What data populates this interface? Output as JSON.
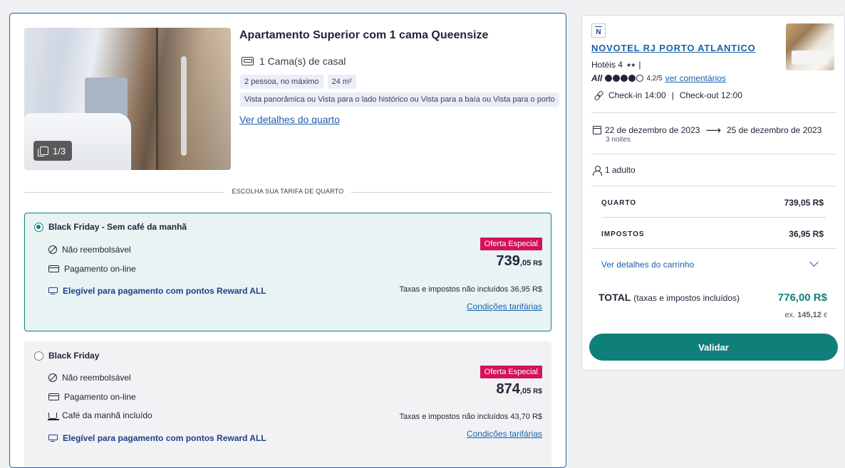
{
  "room": {
    "title": "Apartamento Superior com 1 cama Queensize",
    "beds": "1 Cama(s) de casal",
    "chips_row1": [
      "2 pessoa, no máximo",
      "24 m²"
    ],
    "views": "Vista panorâmica ou Vista para o lado histórico ou Vista para a baía ou Vista para o porto",
    "details_link": "Ver detalhes do quarto",
    "photo_counter": "1/3"
  },
  "rate_section_label": "ESCOLHA SUA TARIFA DE QUARTO",
  "rates": [
    {
      "name": "Black Friday - Sem café da manhã",
      "selected": true,
      "features": [
        "Não reembolsável",
        "Pagamento on-line"
      ],
      "reward": "Elegível para pagamento com pontos Reward ALL",
      "badge": "Oferta Especial",
      "price_int": "739",
      "price_dec": ",05",
      "currency": "R$",
      "taxes": "Taxas e impostos não incluídos 36,95 R$",
      "conditions": "Condições tarifárias"
    },
    {
      "name": "Black Friday",
      "selected": false,
      "features": [
        "Não reembolsável",
        "Pagamento on-line",
        "Café da manhã incluído"
      ],
      "reward": "Elegível para pagamento com pontos Reward ALL",
      "badge": "Oferta Especial",
      "price_int": "874",
      "price_dec": ",05",
      "currency": "R$",
      "taxes": "Taxas e impostos não incluídos 43,70 R$",
      "conditions": "Condições tarifárias"
    }
  ],
  "summary": {
    "brand_letter": "N",
    "hotel_name": "NOVOTEL RJ PORTO ATLANTICO",
    "category": "Hotéis 4",
    "stars_glyph": "★★",
    "separator": "|",
    "all_logo": "All",
    "rating_dots_filled": 4,
    "rating_dots_total": 5,
    "rating_score": "4,2/5",
    "reviews_link": "ver comentários",
    "checkin": "Check-in 14:00",
    "checkout": "Check-out 12:00",
    "date_from": "22 de dezembro de 2023",
    "date_to": "25 de dezembro de 2023",
    "nights": "3 noites",
    "guests": "1 adulto",
    "room_label": "QUARTO",
    "room_price": "739,05 R$",
    "tax_label": "IMPOSTOS",
    "tax_price": "36,95 R$",
    "cart_link": "Ver detalhes do carrinho",
    "total_label": "TOTAL",
    "total_note": "(taxas e impostos incluídos)",
    "total_price": "776,00 R$",
    "ex_prefix": "ex.",
    "ex_value": "145,12",
    "ex_currency": "€",
    "validate_label": "Validar"
  },
  "colors": {
    "accent_teal": "#0f7f79",
    "link_blue": "#1b5fa9",
    "offer_pink": "#d4115a",
    "selected_bg": "#e8f4f4"
  }
}
